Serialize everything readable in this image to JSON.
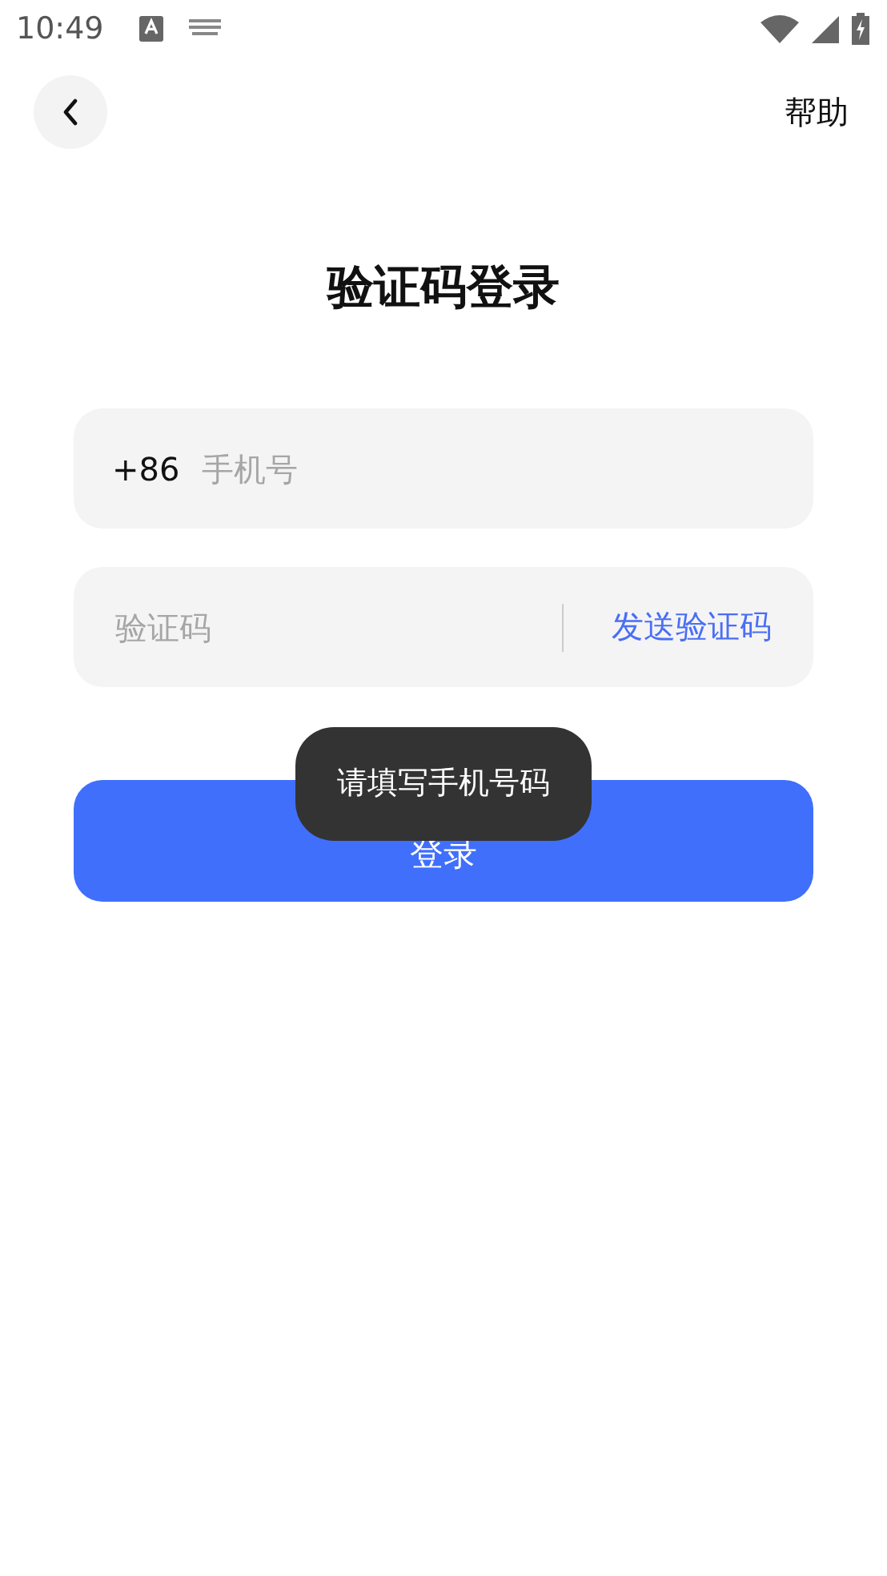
{
  "status_bar": {
    "time": "10:49"
  },
  "header": {
    "help": "帮助"
  },
  "title": "验证码登录",
  "phone_field": {
    "country_code": "+86",
    "placeholder": "手机号"
  },
  "code_field": {
    "placeholder": "验证码",
    "send_button": "发送验证码"
  },
  "login_button": "登录",
  "toast": "请填写手机号码"
}
